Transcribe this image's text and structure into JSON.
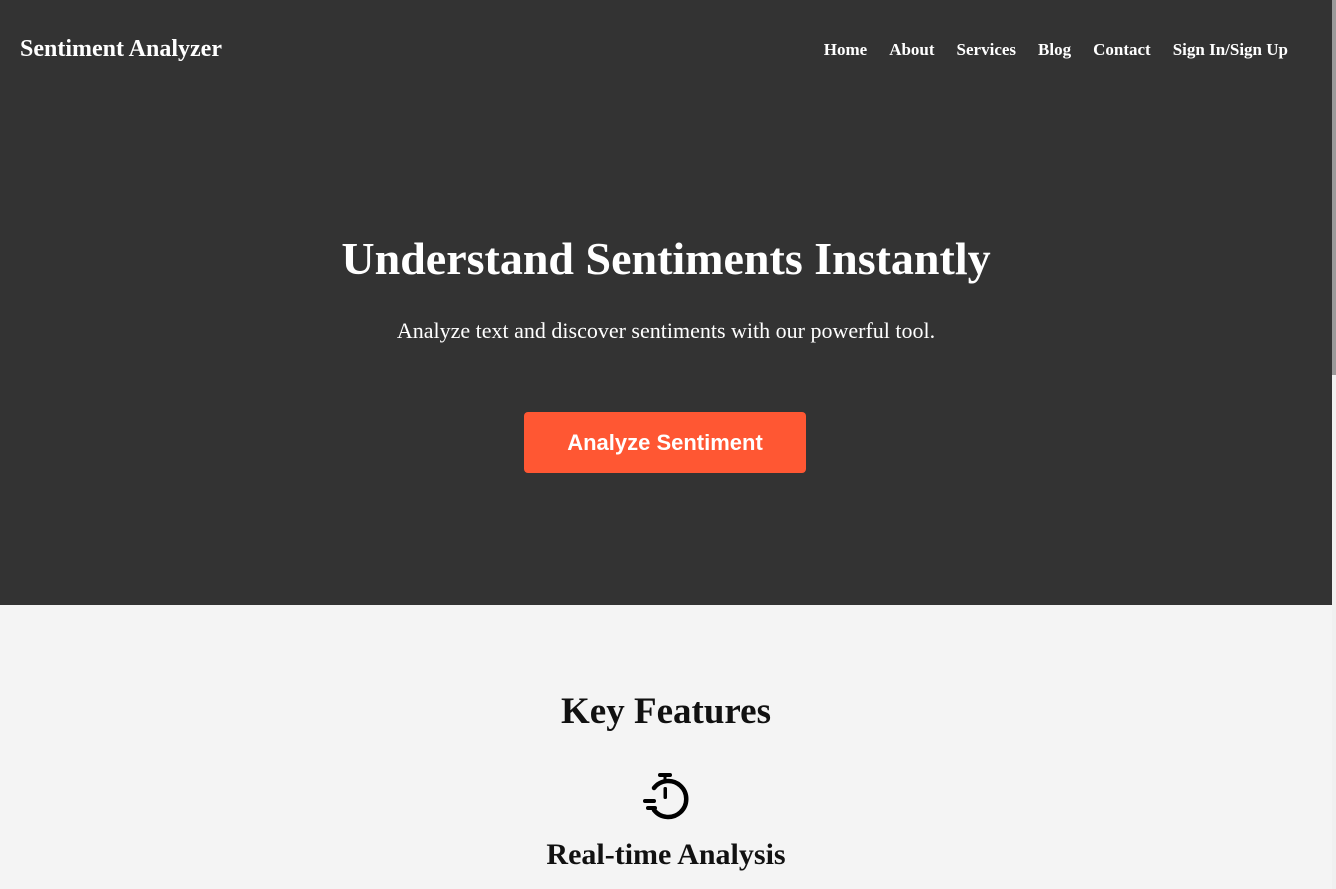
{
  "header": {
    "brand": "Sentiment Analyzer",
    "nav": [
      "Home",
      "About",
      "Services",
      "Blog",
      "Contact",
      "Sign In/Sign Up"
    ]
  },
  "hero": {
    "title": "Understand Sentiments Instantly",
    "subtitle": "Analyze text and discover sentiments with our powerful tool.",
    "cta_label": "Analyze Sentiment",
    "background_color": "#333333",
    "cta_color": "#ff5733"
  },
  "features": {
    "title": "Key Features",
    "items": [
      {
        "icon": "stopwatch-icon",
        "title": "Real-time Analysis"
      }
    ]
  }
}
